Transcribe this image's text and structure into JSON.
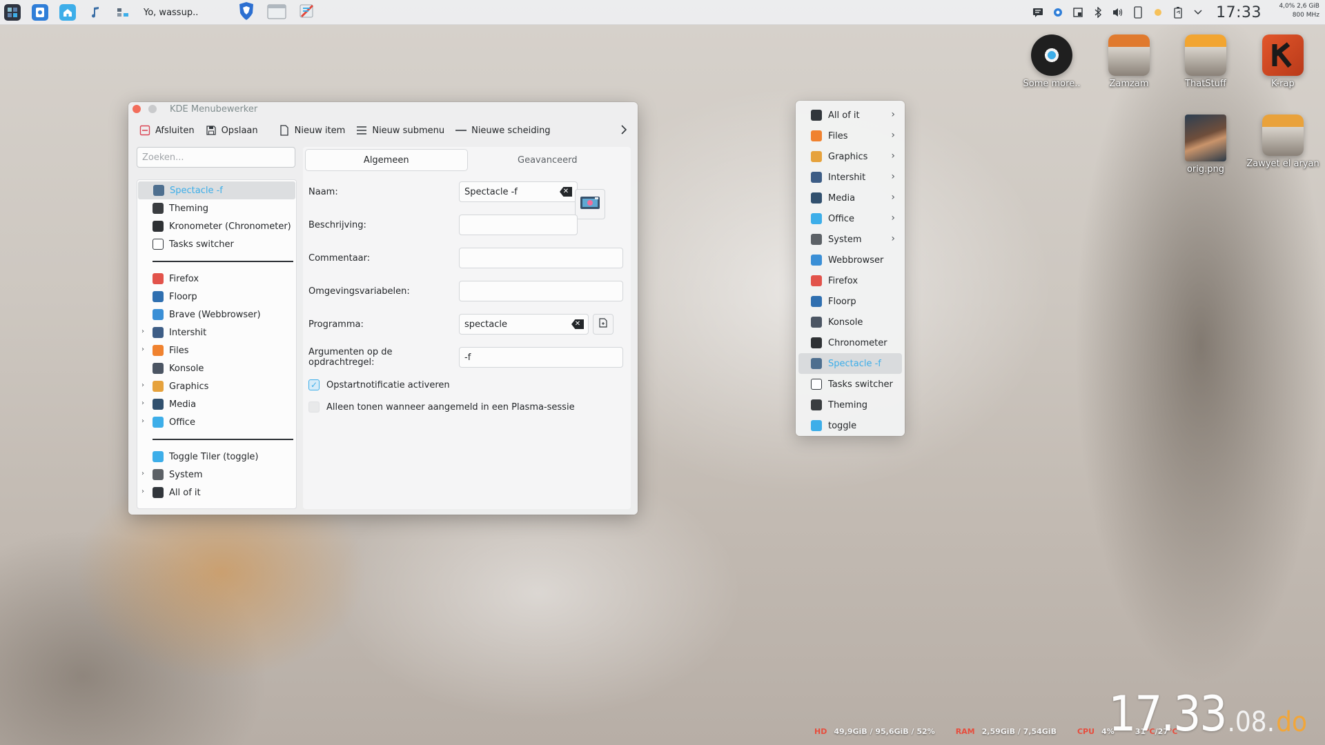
{
  "panel": {
    "window_title": "Yo, wassup..",
    "clock": "17:33",
    "sys_line1": "4,0%  2,6 GiB",
    "sys_line2": "800 MHz",
    "launchers": [
      "app-grid-icon",
      "discover-icon",
      "home-folder-icon",
      "music-note-icon",
      "network-icon"
    ],
    "tasks": [
      "brave-browser-icon",
      "file-manager-icon",
      "kde-menu-editor-icon"
    ],
    "tray": [
      "notes-icon",
      "settings-icon",
      "clipboard-icon",
      "bluetooth-icon",
      "volume-icon",
      "phone-icon",
      "night-light-icon",
      "battery-icon",
      "chevron-down-icon"
    ]
  },
  "window": {
    "title": "KDE Menubewerker",
    "toolbar": {
      "quit": "Afsluiten",
      "save": "Opslaan",
      "new_item": "Nieuw item",
      "new_submenu": "Nieuw submenu",
      "new_separator": "Nieuwe scheiding"
    },
    "search_placeholder": "Zoeken...",
    "tree": [
      {
        "label": "Spectacle -f",
        "icon_color": "#4e6f8f",
        "selected": true
      },
      {
        "label": "Theming",
        "icon_color": "#3a3d40"
      },
      {
        "label": "Kronometer (Chronometer)",
        "icon_color": "#2e3134"
      },
      {
        "label": "Tasks switcher",
        "icon_color": "#ffffff"
      },
      {
        "separator": true
      },
      {
        "label": "Firefox",
        "icon_color": "#e2534b"
      },
      {
        "label": "Floorp",
        "icon_color": "#2f6fb0"
      },
      {
        "label": "Brave  (Webbrowser)",
        "icon_color": "#3a8fd6"
      },
      {
        "label": "Intershit",
        "icon_color": "#3d5d86",
        "expandable": true
      },
      {
        "label": "Files",
        "icon_color": "#f0822f",
        "expandable": true
      },
      {
        "label": "Konsole",
        "icon_color": "#4b5563"
      },
      {
        "label": "Graphics",
        "icon_color": "#e6a23c",
        "expandable": true
      },
      {
        "label": "Media",
        "icon_color": "#31506e",
        "expandable": true
      },
      {
        "label": "Office",
        "icon_color": "#3daee9",
        "expandable": true
      },
      {
        "separator": true
      },
      {
        "label": "Toggle Tiler (toggle)",
        "icon_color": "#3daee9"
      },
      {
        "label": "System",
        "icon_color": "#5c6166",
        "expandable": true
      },
      {
        "label": "All of it",
        "icon_color": "#31363b",
        "expandable": true
      }
    ],
    "tabs": {
      "general": "Algemeen",
      "advanced": "Geavanceerd"
    },
    "form": {
      "name_label": "Naam:",
      "name_value": "Spectacle -f",
      "description_label": "Beschrijving:",
      "description_value": "",
      "comment_label": "Commentaar:",
      "comment_value": "",
      "env_label": "Omgevingsvariabelen:",
      "env_value": "",
      "program_label": "Programma:",
      "program_value": "spectacle",
      "args_label": "Argumenten op de opdrachtregel:",
      "args_value": "-f",
      "startup_notify_label": "Opstartnotificatie activeren",
      "plasma_only_label": "Alleen tonen wanneer aangemeld in een Plasma-sessie"
    }
  },
  "launcher_menu": [
    {
      "label": "All of it",
      "icon_color": "#31363b",
      "submenu": true
    },
    {
      "label": "Files",
      "icon_color": "#f0822f",
      "submenu": true
    },
    {
      "label": "Graphics",
      "icon_color": "#e6a23c",
      "submenu": true
    },
    {
      "label": "Intershit",
      "icon_color": "#3d5d86",
      "submenu": true
    },
    {
      "label": "Media",
      "icon_color": "#31506e",
      "submenu": true
    },
    {
      "label": "Office",
      "icon_color": "#3daee9",
      "submenu": true
    },
    {
      "label": "System",
      "icon_color": "#5c6166",
      "submenu": true
    },
    {
      "label": "Webbrowser",
      "icon_color": "#3a8fd6"
    },
    {
      "label": "Firefox",
      "icon_color": "#e2534b"
    },
    {
      "label": "Floorp",
      "icon_color": "#2f6fb0"
    },
    {
      "label": "Konsole",
      "icon_color": "#4b5563"
    },
    {
      "label": "Chronometer",
      "icon_color": "#2e3134"
    },
    {
      "label": "Spectacle -f",
      "icon_color": "#4e6f8f",
      "selected": true
    },
    {
      "label": "Tasks switcher",
      "icon_color": "#ffffff"
    },
    {
      "label": "Theming",
      "icon_color": "#3a3d40"
    },
    {
      "label": "toggle",
      "icon_color": "#3daee9"
    }
  ],
  "desktop_icons": [
    {
      "label": "Some more..",
      "icon": "turntable-icon",
      "color": "#2b2b2b"
    },
    {
      "label": "Zamzam",
      "icon": "folder-photos-icon",
      "color": "#e07a2e"
    },
    {
      "label": "ThatStuff",
      "icon": "folder-photos-icon",
      "color": "#f2a531"
    },
    {
      "label": "K-rap",
      "icon": "k-rap-icon",
      "color": "#e2562a"
    },
    {
      "label": "orig.png",
      "icon": "portrait-image-icon",
      "color": "#3a4f62"
    },
    {
      "label": "Zawyet el aryan",
      "icon": "folder-photos-icon",
      "color": "#e9a23b"
    }
  ],
  "stats": {
    "hd_label": "HD",
    "hd_value": "49,9GiB / 95,6GiB / 52%",
    "ram_label": "RAM",
    "ram_value": "2,59GiB / 7,54GiB",
    "cpu_label": "CPU",
    "cpu_value": "4%",
    "temp_value": "31",
    "temp_unit1": "°C",
    "temp_sep": " / ",
    "temp_value2": "27",
    "temp_unit2": "°C"
  },
  "big_clock": {
    "time": "17.33",
    "date": ".08.",
    "day": "do"
  }
}
